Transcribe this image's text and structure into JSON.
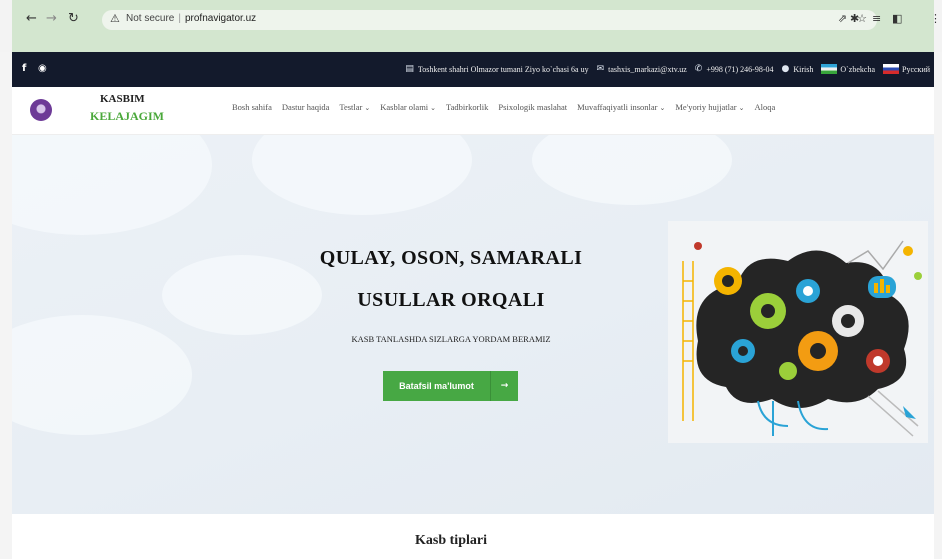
{
  "browser": {
    "security_label": "Not secure",
    "url": "profnavigator.uz",
    "nav_icons": [
      "back-icon",
      "forward-icon",
      "reload-icon"
    ],
    "extension_icons": [
      "share-icon",
      "star-icon",
      "puzzle-icon",
      "reading-list-icon",
      "sidebar-icon",
      "menu-icon"
    ]
  },
  "topbar": {
    "social": [
      "facebook-icon",
      "instagram-icon"
    ],
    "address": "Toshkent shahri Olmazor tumani Ziyo ko`chasi 6a uy",
    "email": "tashxis_markazi@xtv.uz",
    "phone": "+998 (71) 246-98-04",
    "login": "Kirish",
    "lang_uz": "O`zbekcha",
    "lang_ru": "Русский"
  },
  "header": {
    "brand_line1": "KASBIM",
    "brand_line2": "KELAJAGIM",
    "menu": [
      {
        "label": "Bosh sahifa",
        "dropdown": false
      },
      {
        "label": "Dastur haqida",
        "dropdown": false
      },
      {
        "label": "Testlar",
        "dropdown": true
      },
      {
        "label": "Kasblar olami",
        "dropdown": true
      },
      {
        "label": "Tadbirkorlik",
        "dropdown": false
      },
      {
        "label": "Psixologik maslahat",
        "dropdown": false
      },
      {
        "label": "Muvaffaqiyatli insonlar",
        "dropdown": true
      },
      {
        "label": "Me'yoriy hujjatlar",
        "dropdown": true
      },
      {
        "label": "Aloqa",
        "dropdown": false
      }
    ]
  },
  "hero": {
    "title_line1": "QULAY, OSON, SAMARALI",
    "title_line2": "USULLAR ORQALI",
    "subtitle": "KASB TANLASHDA SIZLARGA YORDAM BERAMIZ",
    "button_label": "Batafsil ma'lumot",
    "accent_color": "#47a844"
  },
  "section": {
    "title": "Kasb tiplari"
  }
}
